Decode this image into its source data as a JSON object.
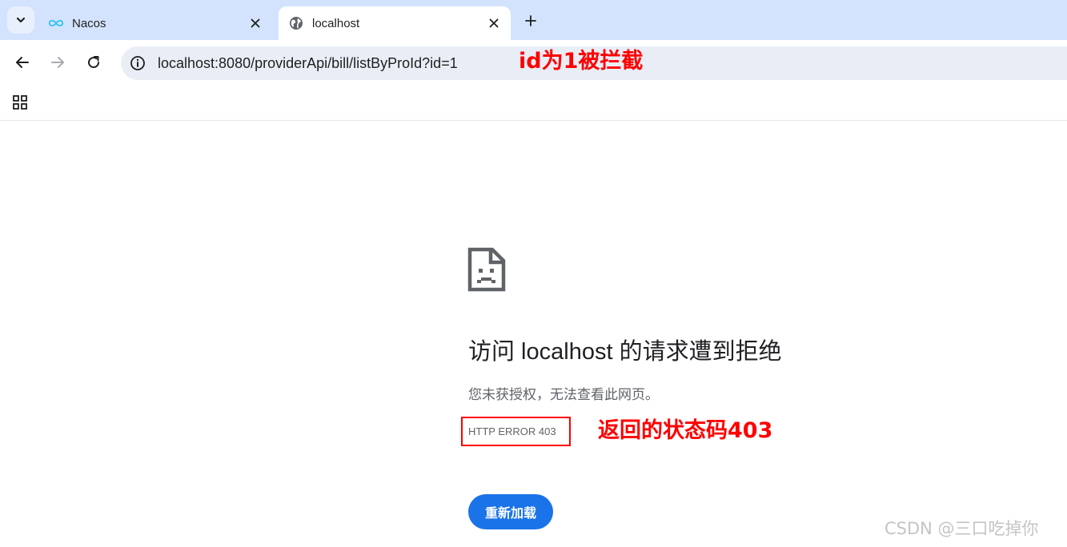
{
  "tabs": [
    {
      "title": "Nacos",
      "active": false,
      "icon": "nacos-infinity-icon"
    },
    {
      "title": "localhost",
      "active": true,
      "icon": "globe-icon"
    }
  ],
  "toolbar": {
    "url": "localhost:8080/providerApi/bill/listByProId?id=1"
  },
  "annotations": {
    "url_note": "id为1被拦截",
    "status_note": "返回的状态码403"
  },
  "error_page": {
    "title": "访问 localhost 的请求遭到拒绝",
    "description": "您未获授权，无法查看此网页。",
    "error_code": "HTTP ERROR 403",
    "reload_label": "重新加载"
  },
  "watermark": "CSDN @三口吃掉你",
  "colors": {
    "tabstrip": "#d3e3fd",
    "omnibox": "#e9eef6",
    "accent": "#1a73e8",
    "annotation": "#ff0000"
  }
}
